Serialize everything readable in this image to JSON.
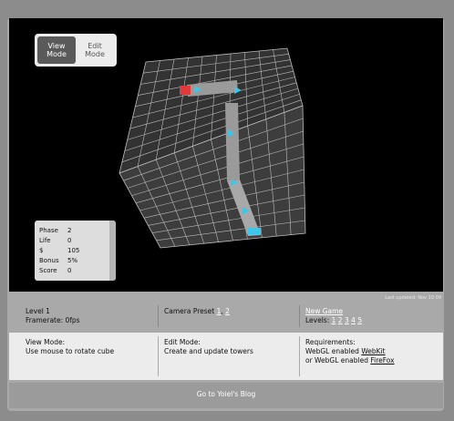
{
  "mode_toggle": {
    "view_label": "View\nMode",
    "edit_label": "Edit\nMode",
    "active": "view"
  },
  "stats": {
    "rows": [
      {
        "key": "Phase",
        "value": "2"
      },
      {
        "key": "Life",
        "value": "0"
      },
      {
        "key": "$",
        "value": "105"
      },
      {
        "key": "Bonus",
        "value": "5%"
      },
      {
        "key": "Score",
        "value": "0"
      }
    ]
  },
  "last_updated": "Last updated: Nov 10 09",
  "info": {
    "level_label": "Level 1",
    "framerate_label": "Framerate: 0fps",
    "camera_preset_label": "Camera Preset",
    "camera_presets": [
      "1",
      "2"
    ],
    "new_game_label": "New Game",
    "levels_label": "Levels:",
    "levels": [
      "1",
      "2",
      "3",
      "4",
      "5"
    ]
  },
  "panel": {
    "view_mode_title": "View Mode:",
    "view_mode_desc": "Use mouse to rotate cube",
    "edit_mode_title": "Edit Mode:",
    "edit_mode_desc": "Create and update towers",
    "requirements_title": "Requirements:",
    "req_line1_prefix": "WebGL enabled",
    "req_line1_link": "WebKit",
    "req_line2_prefix": "or WebGL enabled",
    "req_line2_link": "FireFox"
  },
  "footer": {
    "label": "Go to Yoiel's Blog"
  },
  "colors": {
    "path": "#9a9a9a",
    "grid_line": "#bdbdbd",
    "tower": "#3ec5e8",
    "start": "#e03a3a"
  }
}
